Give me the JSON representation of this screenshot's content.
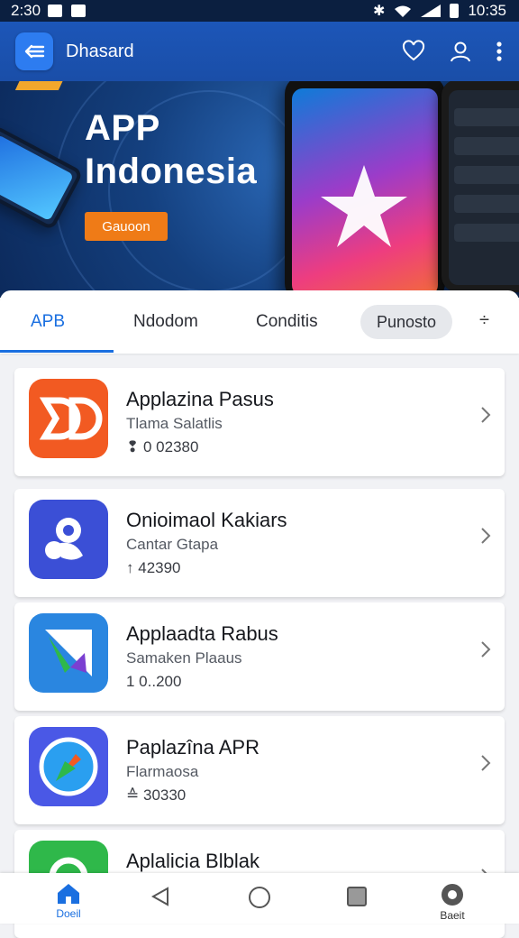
{
  "status_bar": {
    "time_left": "2:30",
    "time_right": "10:35"
  },
  "app_bar": {
    "title": "Dhasard"
  },
  "banner": {
    "headline_line1": "APP",
    "headline_line2": "Indonesia",
    "cta_label": "Gauoon"
  },
  "tabs": [
    {
      "label": "APB",
      "active": true
    },
    {
      "label": "Ndodom"
    },
    {
      "label": "Conditis"
    },
    {
      "label": "Punosto",
      "selected_pill": true
    }
  ],
  "tab_more_glyph": "÷",
  "apps": [
    {
      "name": "Applazina Pasus",
      "developer": "Tlama Salatlis",
      "meta": "0 02380",
      "meta_prefix": "❢",
      "icon": "orange-od-icon",
      "color": "#f25a22"
    },
    {
      "name": "Onioimaol Kakiars",
      "developer": "Cantar Gtapa",
      "meta": "42390",
      "meta_prefix": "↑",
      "icon": "blue-blob-icon",
      "color": "#3b4fd6"
    },
    {
      "name": "Applaadta Rabus",
      "developer": "Samaken Plaaus",
      "meta": "1 0..200",
      "meta_prefix": "",
      "icon": "blue-arrow-icon",
      "color": "#2a86e0"
    },
    {
      "name": "Paplazîna APR",
      "developer": "Flarmaosa",
      "meta": "30330",
      "meta_prefix": "≙",
      "icon": "compass-icon",
      "color": "#4a58e6"
    },
    {
      "name": "Aplalicia Blblak",
      "developer": "",
      "meta": "",
      "meta_prefix": "",
      "icon": "green-app-icon",
      "color": "#2fb84a"
    }
  ],
  "bottom_nav": {
    "home_label": "Doeil",
    "right_label": "Baeit"
  },
  "colors": {
    "primary": "#1a6fe0",
    "appbar": "#1a4ea8",
    "accent": "#ef7b17"
  }
}
